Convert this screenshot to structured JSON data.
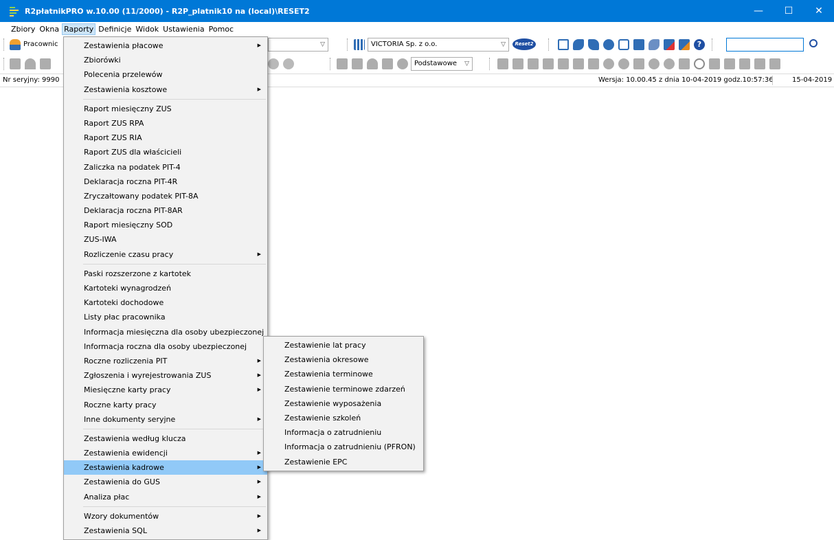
{
  "window": {
    "title": "R2płatnikPRO w.10.00 (11/2000) - R2P_platnik10 na (local)\\RESET2",
    "minimize": "—",
    "maximize": "☐",
    "close": "✕"
  },
  "menubar": [
    "Zbiory",
    "Okna",
    "Raporty",
    "Definicje",
    "Widok",
    "Ustawienia",
    "Pomoc"
  ],
  "toolbar": {
    "module_combo": "Pracownic",
    "company_combo": "VICTORIA Sp. z o.o.",
    "view_combo": "Podstawowe",
    "reset_logo": "Reset2",
    "search_value": ""
  },
  "statusbar": {
    "serial": "Nr seryjny: 9990",
    "version": "Wersja: 10.00.45 z dnia 10-04-2019 godz.10:57:36",
    "date": "15-04-2019"
  },
  "raporty_menu": [
    {
      "label": "Zestawienia płacowe",
      "sub": true
    },
    {
      "label": "Zbiorówki",
      "sub": false
    },
    {
      "label": "Polecenia przelewów",
      "sub": false
    },
    {
      "label": "Zestawienia kosztowe",
      "sub": true
    },
    {
      "sep": true
    },
    {
      "label": "Raport miesięczny ZUS",
      "sub": false
    },
    {
      "label": "Raport ZUS RPA",
      "sub": false
    },
    {
      "label": "Raport ZUS RIA",
      "sub": false
    },
    {
      "label": "Raport ZUS dla właścicieli",
      "sub": false
    },
    {
      "label": "Zaliczka na podatek PIT-4",
      "sub": false
    },
    {
      "label": "Deklaracja roczna PIT-4R",
      "sub": false
    },
    {
      "label": "Zryczałtowany podatek PIT-8A",
      "sub": false
    },
    {
      "label": "Deklaracja roczna PIT-8AR",
      "sub": false
    },
    {
      "label": "Raport miesięczny SOD",
      "sub": false
    },
    {
      "label": "ZUS-IWA",
      "sub": false
    },
    {
      "label": "Rozliczenie czasu pracy",
      "sub": true
    },
    {
      "sep": true
    },
    {
      "label": "Paski rozszerzone z kartotek",
      "sub": false
    },
    {
      "label": "Kartoteki wynagrodzeń",
      "sub": false
    },
    {
      "label": "Kartoteki dochodowe",
      "sub": false
    },
    {
      "label": "Listy płac pracownika",
      "sub": false
    },
    {
      "label": "Informacja miesięczna dla osoby ubezpieczonej",
      "sub": false
    },
    {
      "label": "Informacja roczna dla osoby ubezpieczonej",
      "sub": false
    },
    {
      "label": "Roczne rozliczenia PIT",
      "sub": true
    },
    {
      "label": "Zgłoszenia i wyrejestrowania ZUS",
      "sub": true
    },
    {
      "label": "Miesięczne karty pracy",
      "sub": true
    },
    {
      "label": "Roczne karty pracy",
      "sub": false
    },
    {
      "label": "Inne dokumenty seryjne",
      "sub": true
    },
    {
      "sep": true
    },
    {
      "label": "Zestawienia według klucza",
      "sub": false
    },
    {
      "label": "Zestawienia ewidencji",
      "sub": true
    },
    {
      "label": "Zestawienia kadrowe",
      "sub": true,
      "highlighted": true
    },
    {
      "label": "Zestawienia do GUS",
      "sub": true
    },
    {
      "label": "Analiza płac",
      "sub": true
    },
    {
      "sep": true
    },
    {
      "label": "Wzory dokumentów",
      "sub": true
    },
    {
      "label": "Zestawienia SQL",
      "sub": true
    }
  ],
  "kadrowe_submenu": [
    "Zestawienie lat pracy",
    "Zestawienia okresowe",
    "Zestawienia terminowe",
    "Zestawienie terminowe zdarzeń",
    "Zestawienie wyposażenia",
    "Zestawienie szkoleń",
    "Informacja o zatrudnieniu",
    "Informacja o zatrudnieniu (PFRON)",
    "Zestawienie EPC"
  ],
  "colors": {
    "titlebar": "#0078d7",
    "menu_highlight": "#91c9f7",
    "menu_bg": "#f2f2f2"
  }
}
